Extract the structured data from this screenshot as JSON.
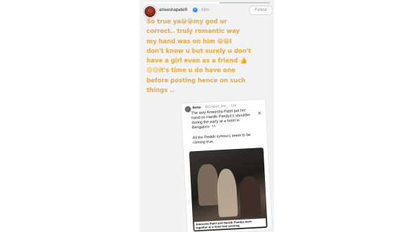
{
  "story": {
    "progress_fraction": 0.6,
    "username": "ameeshapatel9",
    "verified": "✓",
    "time": "43m",
    "follow_label": "Follow",
    "caption": "So true ya😁😁my god ur\ncorrect.. truly romantic way\nmy hand was on him 😁😁I\ndon't know u but surely u don't\nhave a girl even as a friend 👍\n😛😛it's time u do have one\nbefore posting  hence on such\nthings .."
  },
  "tweet": {
    "name": "Sonu",
    "handle": "@Cricket_live_ · 11h",
    "close": "✕",
    "text": "The way Ameesha Patel put her\nhand on Hardik Pandya's shoulder\nduring the party at a hotel in\nBengaluru. 👀",
    "text2": "All the Reddit rumours seem to be\ncoming true.",
    "video_caption": "Ameesha Patel and Hardik Pandya were\ntogether at a hotel last evening"
  },
  "colors": {
    "caption": "#e8b14f",
    "story_bg": "#f2f2f2",
    "verified": "#3b8cff"
  }
}
